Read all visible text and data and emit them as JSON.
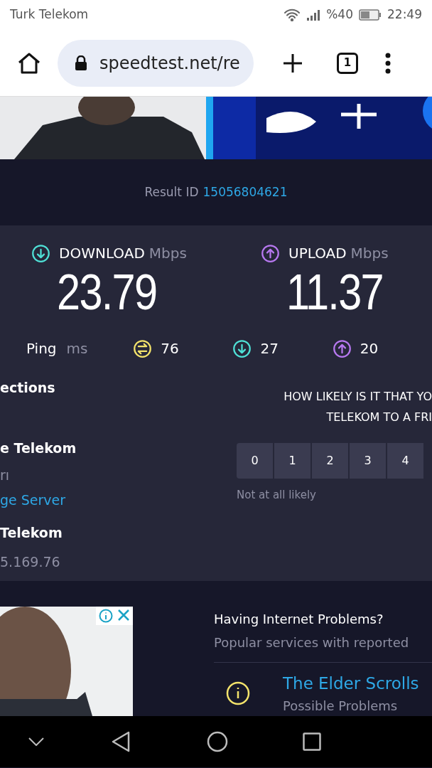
{
  "status_bar": {
    "carrier": "Turk Telekom",
    "battery": "%40",
    "time": "22:49"
  },
  "browser": {
    "url": "speedtest.net/re",
    "tab_count": "1"
  },
  "result": {
    "label": "Result ID",
    "id": "15056804621"
  },
  "speeds": [
    {
      "kind": "download",
      "label": "DOWNLOAD",
      "unit": "Mbps",
      "value": "23.79"
    },
    {
      "kind": "upload",
      "label": "UPLOAD",
      "unit": "Mbps",
      "value": "11.37"
    }
  ],
  "ping": {
    "label": "Ping",
    "unit": "ms",
    "items": [
      {
        "kind": "ping",
        "value": "76"
      },
      {
        "kind": "download",
        "value": "27"
      },
      {
        "kind": "upload",
        "value": "20"
      }
    ]
  },
  "connections": {
    "title": "ections",
    "isp": "e Telekom",
    "isp_location": "rı",
    "change_server": "ge Server",
    "host": "Telekom",
    "ip": "5.169.76"
  },
  "survey": {
    "question_lines": [
      "HOW LIKELY IS IT THAT YO",
      "TELEKOM TO A FRI"
    ],
    "options": [
      "0",
      "1",
      "2",
      "3",
      "4"
    ],
    "low_label": "Not at all likely"
  },
  "problems": {
    "title": "Having Internet Problems?",
    "subtitle": "Popular services with reported",
    "items": [
      {
        "name": "The Elder Scrolls",
        "status": "Possible Problems"
      }
    ]
  }
}
